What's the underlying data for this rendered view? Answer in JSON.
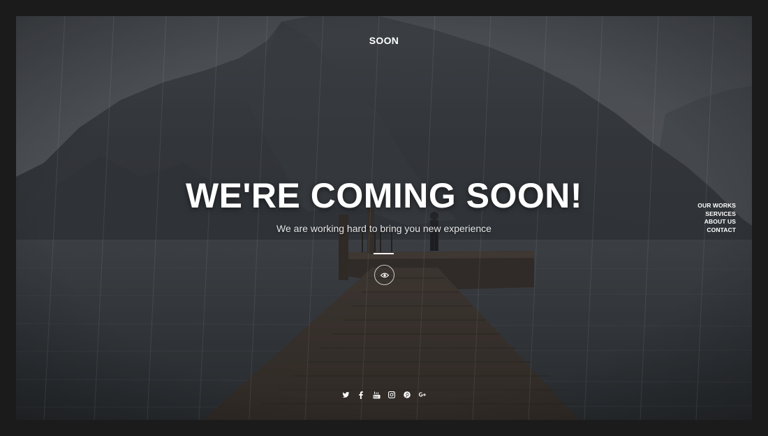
{
  "brand": {
    "logo": "SOON"
  },
  "hero": {
    "headline": "WE'RE COMING SOON!",
    "subtitle": "We are working hard to bring you new experience"
  },
  "nav": {
    "items": [
      {
        "label": "OUR WORKS"
      },
      {
        "label": "SERVICES"
      },
      {
        "label": "ABOUT US"
      },
      {
        "label": "CONTACT"
      }
    ]
  },
  "icons": {
    "view": "eye-icon",
    "social": [
      "twitter-icon",
      "facebook-icon",
      "youtube-icon",
      "instagram-icon",
      "pinterest-icon",
      "google-plus-icon"
    ]
  },
  "colors": {
    "page_background": "#1b1b1b",
    "text": "#ffffff",
    "subtitle": "#e6e6e6"
  }
}
